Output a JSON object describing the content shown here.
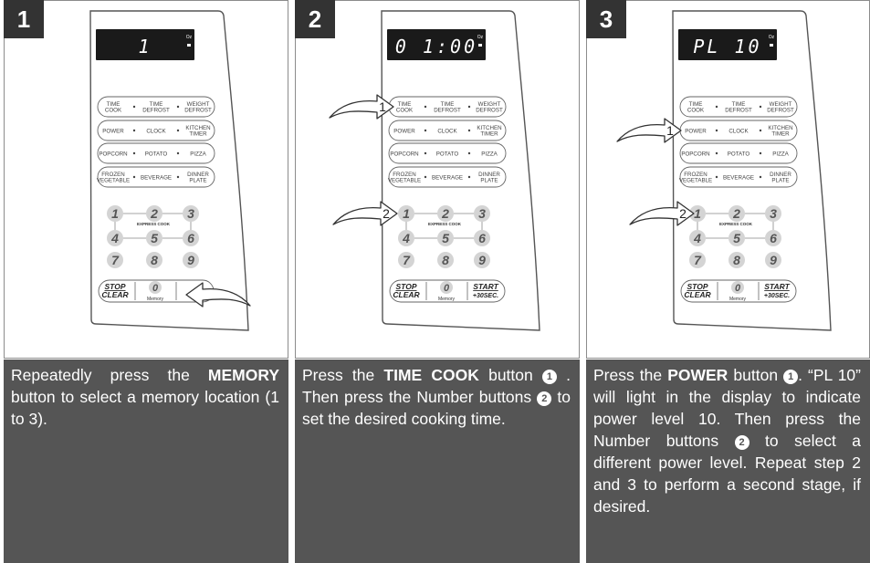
{
  "steps": [
    {
      "number": "1",
      "display": "1",
      "text_parts": [
        "Repeatedly press the ",
        "MEMORY",
        " button to select a memory location (1 to 3)."
      ]
    },
    {
      "number": "2",
      "display": "0 1:00",
      "text_parts": [
        "Press the ",
        "TIME COOK",
        " button ",
        " . Then press the Number buttons ",
        " to set the desired cooking time."
      ],
      "markers": [
        "1",
        "2"
      ]
    },
    {
      "number": "3",
      "display": "PL 10",
      "text_parts": [
        "Press the ",
        "POWER",
        " button ",
        ". “PL 10” will light in the display to indicate power level 10. Then press the Number buttons ",
        " to select a different power level. Repeat step 2 and 3 to perform a second stage, if desired."
      ],
      "markers": [
        "1",
        "2"
      ]
    }
  ],
  "panel": {
    "display_unit": "Oz",
    "function_rows": [
      [
        "TIME COOK",
        "TIME DEFROST",
        "WEIGHT DEFROST"
      ],
      [
        "POWER",
        "CLOCK",
        "KITCHEN TIMER"
      ],
      [
        "POPCORN",
        "POTATO",
        "PIZZA"
      ],
      [
        "FROZEN VEGETABLE",
        "BEVERAGE",
        "DINNER PLATE"
      ]
    ],
    "keypad": [
      "1",
      "2",
      "3",
      "4",
      "5",
      "6",
      "7",
      "8",
      "9"
    ],
    "express_cook": "EXPRESS COOK",
    "stop": "STOP",
    "clear": "CLEAR",
    "zero": "0",
    "memory": "Memory",
    "start": "START",
    "plus30": "+30SEC."
  }
}
